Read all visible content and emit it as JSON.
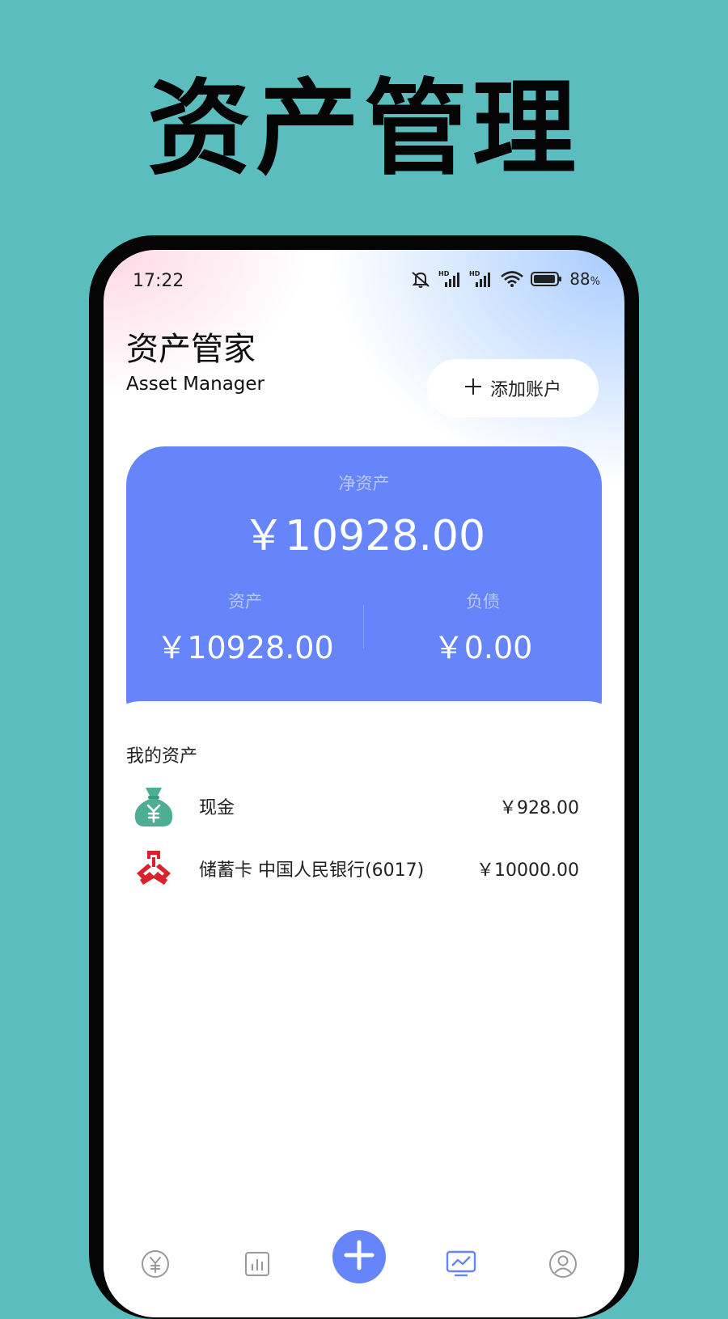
{
  "promo": {
    "title": "资产管理"
  },
  "status_bar": {
    "time": "17:22",
    "battery_pct": "88",
    "battery_unit": "%",
    "icons": [
      "mute-icon",
      "hd-signal-icon",
      "hd-signal-icon",
      "wifi-icon",
      "battery-icon"
    ]
  },
  "header": {
    "title": "资产管家",
    "subtitle": "Asset Manager",
    "add_button_label": "添加账户"
  },
  "summary": {
    "net_label": "净资产",
    "net_value": "￥10928.00",
    "assets_label": "资产",
    "assets_value": "￥10928.00",
    "liabilities_label": "负债",
    "liabilities_value": "￥0.00"
  },
  "assets": {
    "section_title": "我的资产",
    "items": [
      {
        "name": "现金",
        "amount": "￥928.00",
        "icon": "money-bag-icon"
      },
      {
        "name": "储蓄卡 中国人民银行(6017)",
        "amount": "￥10000.00",
        "icon": "bank-logo-icon"
      }
    ]
  },
  "bottom_nav": {
    "items": [
      "yuan-icon",
      "bar-chart-icon",
      "add-icon",
      "trend-chart-icon",
      "profile-icon"
    ]
  },
  "colors": {
    "background": "#5bbdbe",
    "accent": "#6685fb",
    "money_bag": "#4eae93",
    "bank_red": "#d9232a"
  }
}
